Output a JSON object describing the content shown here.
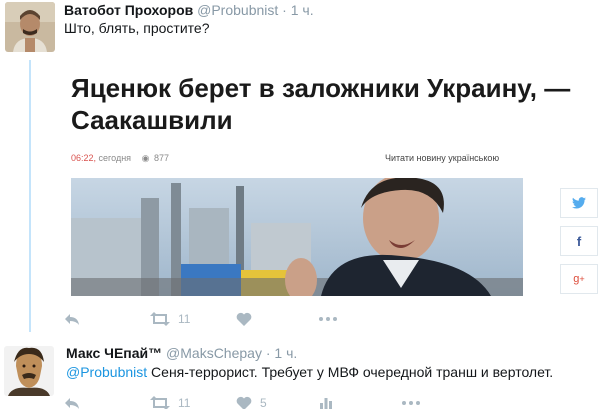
{
  "tweet1": {
    "author_name": "Ватобот Прохоров",
    "author_handle": "@Probubnist",
    "separator": "·",
    "time": "1 ч.",
    "text": "Што, блять, простите?",
    "article": {
      "headline": "Яценюк берет в заложники Украину, — Саакашвили",
      "time": "06:22,",
      "date": "сегодня",
      "views": "877",
      "read_in_ukrainian": "Читати новину українською"
    },
    "actions": {
      "retweet_count": "11",
      "like_count": ""
    }
  },
  "tweet2": {
    "author_name": "Макс ЧЕпай™",
    "author_handle": "@MaksChepay",
    "separator": "·",
    "time": "1 ч.",
    "mention": "@Probubnist",
    "text": "Сеня-террорист. Требует у МВФ очередной транш и вертолет.",
    "actions": {
      "retweet_count": "11",
      "like_count": "5"
    }
  },
  "share_icons": [
    "twitter-icon",
    "facebook-icon",
    "google-plus-icon"
  ],
  "colors": {
    "link": "#1b95e0",
    "muted": "#aab8c2",
    "thread": "#c4e4fb",
    "article_time": "#d9534f"
  }
}
